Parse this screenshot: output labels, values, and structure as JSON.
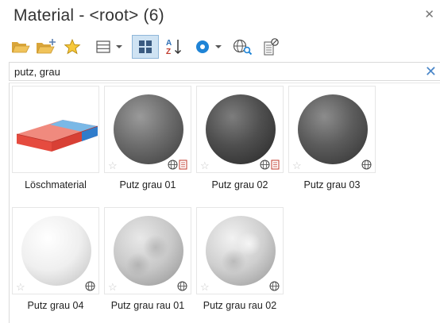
{
  "window": {
    "title": "Material - <root> (6)"
  },
  "toolbar": {
    "icons": [
      "folder-open-icon",
      "folder-add-icon",
      "favorites-star-icon",
      "list-view-icon",
      "dropdown-arrow-icon",
      "large-icons-view-icon",
      "sort-az-icon",
      "render-preview-icon",
      "dropdown-arrow-icon",
      "web-search-icon",
      "library-settings-icon"
    ],
    "active_view": "large-icons-view"
  },
  "search": {
    "value": "putz, grau"
  },
  "materials": [
    {
      "label": "Löschmaterial",
      "kind": "eraser",
      "favorite": false,
      "badges": []
    },
    {
      "label": "Putz grau 01",
      "kind": "dark-sphere",
      "favorite": false,
      "badges": [
        "globe-icon",
        "document-icon"
      ]
    },
    {
      "label": "Putz grau 02",
      "kind": "darker-sphere",
      "favorite": false,
      "badges": [
        "globe-icon",
        "document-icon"
      ]
    },
    {
      "label": "Putz grau 03",
      "kind": "mid-sphere",
      "favorite": false,
      "badges": [
        "globe-icon"
      ]
    },
    {
      "label": "Putz grau 04",
      "kind": "white-sphere",
      "favorite": false,
      "badges": [
        "globe-icon"
      ]
    },
    {
      "label": "Putz grau rau 01",
      "kind": "rough-sphere",
      "favorite": false,
      "badges": [
        "globe-icon"
      ]
    },
    {
      "label": "Putz grau rau 02",
      "kind": "rough-sphere-2",
      "favorite": false,
      "badges": [
        "globe-icon"
      ]
    }
  ],
  "colors": {
    "accent": "#4a86c8",
    "active_button": "#cfe3f3",
    "folder": "#e8b84a"
  }
}
